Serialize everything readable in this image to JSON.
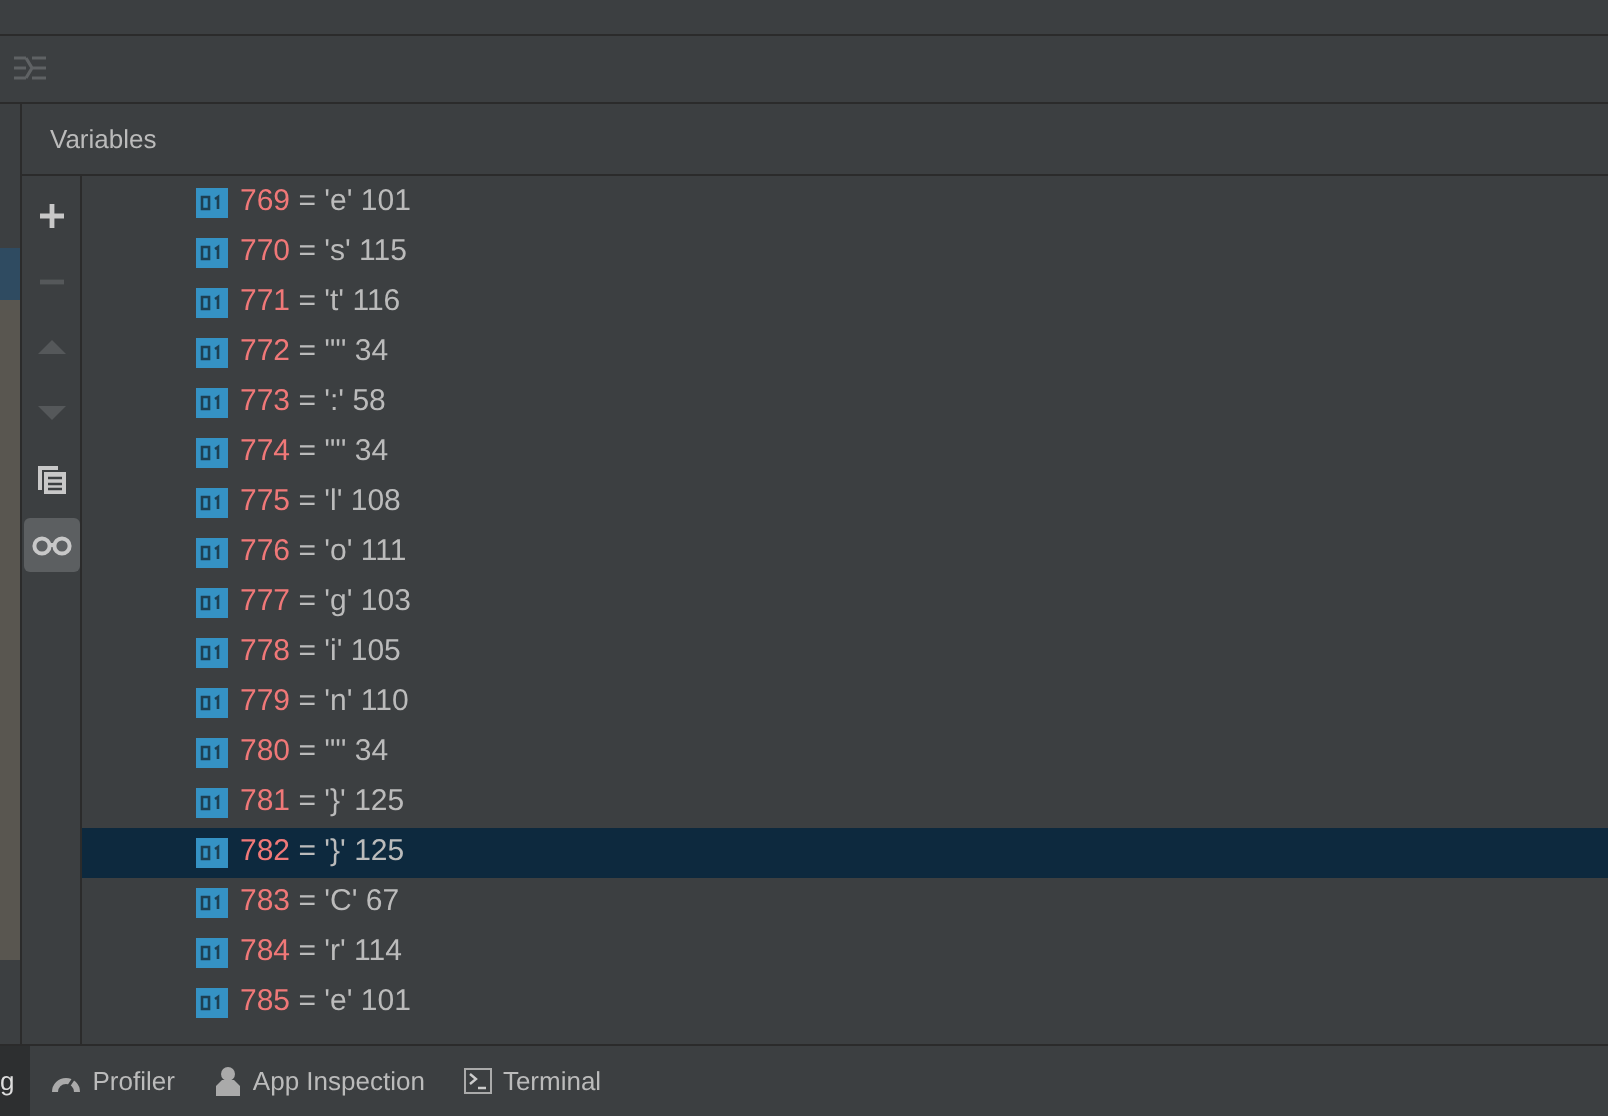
{
  "panel": {
    "title": "Variables"
  },
  "tools": [
    {
      "kind": "add",
      "disabled": false,
      "selected": false
    },
    {
      "kind": "remove",
      "disabled": true,
      "selected": false
    },
    {
      "kind": "up",
      "disabled": true,
      "selected": false
    },
    {
      "kind": "down",
      "disabled": true,
      "selected": false
    },
    {
      "kind": "copy",
      "disabled": false,
      "selected": false
    },
    {
      "kind": "glasses",
      "disabled": false,
      "selected": true
    }
  ],
  "variables": [
    {
      "index": "769",
      "operator": "=",
      "value": "'e'",
      "code": "101",
      "selected": false
    },
    {
      "index": "770",
      "operator": "=",
      "value": "'s'",
      "code": "115",
      "selected": false
    },
    {
      "index": "771",
      "operator": "=",
      "value": "'t'",
      "code": "116",
      "selected": false
    },
    {
      "index": "772",
      "operator": "=",
      "value": "'\"'",
      "code": "34",
      "selected": false
    },
    {
      "index": "773",
      "operator": "=",
      "value": "':'",
      "code": "58",
      "selected": false
    },
    {
      "index": "774",
      "operator": "=",
      "value": "'\"'",
      "code": "34",
      "selected": false
    },
    {
      "index": "775",
      "operator": "=",
      "value": "'l'",
      "code": "108",
      "selected": false
    },
    {
      "index": "776",
      "operator": "=",
      "value": "'o'",
      "code": "111",
      "selected": false
    },
    {
      "index": "777",
      "operator": "=",
      "value": "'g'",
      "code": "103",
      "selected": false
    },
    {
      "index": "778",
      "operator": "=",
      "value": "'i'",
      "code": "105",
      "selected": false
    },
    {
      "index": "779",
      "operator": "=",
      "value": "'n'",
      "code": "110",
      "selected": false
    },
    {
      "index": "780",
      "operator": "=",
      "value": "'\"'",
      "code": "34",
      "selected": false
    },
    {
      "index": "781",
      "operator": "=",
      "value": "'}'",
      "code": "125",
      "selected": false
    },
    {
      "index": "782",
      "operator": "=",
      "value": "'}'",
      "code": "125",
      "selected": true
    },
    {
      "index": "783",
      "operator": "=",
      "value": "'C'",
      "code": "67",
      "selected": false
    },
    {
      "index": "784",
      "operator": "=",
      "value": "'r'",
      "code": "114",
      "selected": false
    },
    {
      "index": "785",
      "operator": "=",
      "value": "'e'",
      "code": "101",
      "selected": false
    }
  ],
  "bottom_tabs": [
    {
      "kind": "debug",
      "label": "g",
      "selected": true
    },
    {
      "kind": "profiler",
      "label": "Profiler",
      "selected": false
    },
    {
      "kind": "inspection",
      "label": "App Inspection",
      "selected": false
    },
    {
      "kind": "terminal",
      "label": "Terminal",
      "selected": false
    }
  ]
}
